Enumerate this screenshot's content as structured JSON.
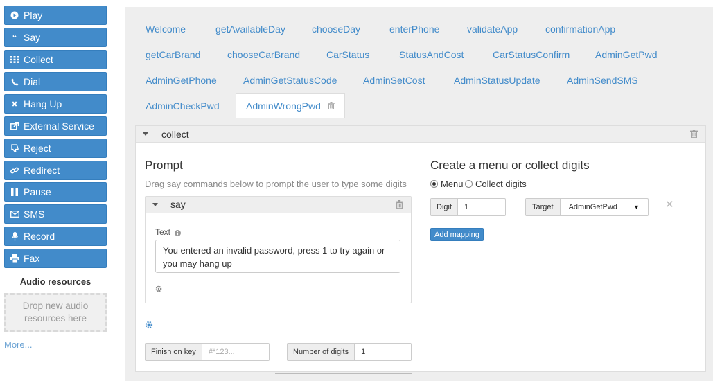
{
  "sidebar": {
    "buttons": [
      {
        "label": "Play",
        "icon": "play-icon"
      },
      {
        "label": "Say",
        "icon": "quote-icon"
      },
      {
        "label": "Collect",
        "icon": "grid-icon"
      },
      {
        "label": "Dial",
        "icon": "phone-icon"
      },
      {
        "label": "Hang Up",
        "icon": "close-icon"
      },
      {
        "label": "External Service",
        "icon": "external-link-icon"
      },
      {
        "label": "Reject",
        "icon": "thumbs-down-icon"
      },
      {
        "label": "Redirect",
        "icon": "link-icon"
      },
      {
        "label": "Pause",
        "icon": "pause-icon"
      },
      {
        "label": "SMS",
        "icon": "envelope-icon"
      },
      {
        "label": "Record",
        "icon": "microphone-icon"
      },
      {
        "label": "Fax",
        "icon": "print-icon"
      }
    ],
    "audio_title": "Audio resources",
    "audio_drop": "Drop new audio resources here",
    "more_link": "More..."
  },
  "tabs": [
    "Welcome",
    "getAvailableDay",
    "chooseDay",
    "enterPhone",
    "validateApp",
    "confirmationApp",
    "getCarBrand",
    "chooseCarBrand",
    "CarStatus",
    "StatusAndCost",
    "CarStatusConfirm",
    "AdminGetPwd",
    "AdminGetPhone",
    "AdminGetStatusCode",
    "AdminSetCost",
    "AdminStatusUpdate",
    "AdminSendSMS",
    "AdminCheckPwd",
    "AdminWrongPwd"
  ],
  "active_tab": "AdminWrongPwd",
  "panel": {
    "title": "collect",
    "prompt_title": "Prompt",
    "prompt_desc": "Drag say commands below to prompt the user to type some digits",
    "say": {
      "title": "say",
      "text_label": "Text",
      "text_value": "You entered an invalid password, press 1 to try again or you may hang up"
    },
    "finish_label": "Finish on key",
    "finish_placeholder": "#*123...",
    "digits_label": "Number of digits",
    "digits_value": "1",
    "menu_title": "Create a menu or collect digits",
    "radio_menu": "Menu",
    "radio_collect": "Collect digits",
    "radio_selected": "Menu",
    "mapping": {
      "digit_label": "Digit",
      "digit_value": "1",
      "target_label": "Target",
      "target_value": "AdminGetPwd"
    },
    "add_mapping": "Add mapping"
  },
  "colors": {
    "primary": "#428bca",
    "tab_link": "#428bca",
    "panel_bg": "#eeeeee"
  }
}
